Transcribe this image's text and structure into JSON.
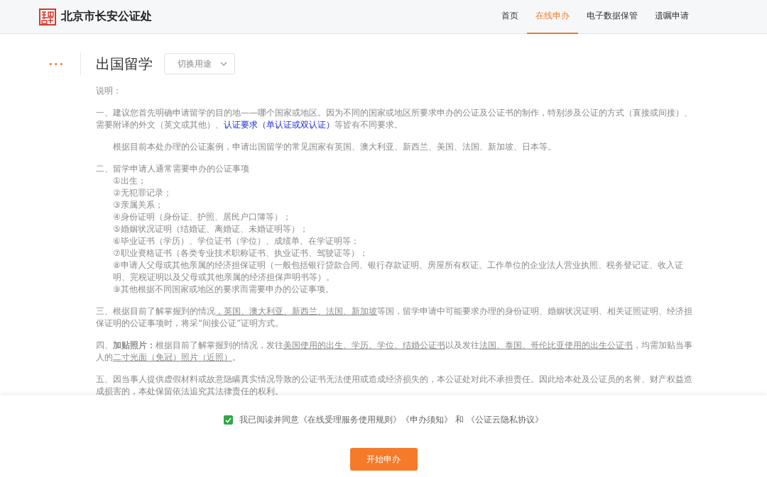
{
  "header": {
    "logo_text": "北京市长安公证处",
    "nav": [
      {
        "label": "首页",
        "selected": false
      },
      {
        "label": "在线申办",
        "selected": true
      },
      {
        "label": "电子数据保管",
        "selected": false
      },
      {
        "label": "遗嘱申请",
        "selected": false
      }
    ]
  },
  "page": {
    "more": "•••",
    "title": "出国留学",
    "switch_label": "切换用途"
  },
  "notes": [
    {
      "kind": "para",
      "segments": [
        {
          "kind": "text",
          "text": "说明："
        }
      ]
    },
    {
      "kind": "para",
      "segments": [
        {
          "kind": "text",
          "text": "一、建议您首先明确申请留学的目的地——哪个国家或地区。因为不同的国家或地区所要求申办的公证及公证书的制作，特别涉及公证的方式（直接或间接）、需要附译的外文（英文或其他）、"
        },
        {
          "kind": "link",
          "text": "认证要求（单认证或双认证）"
        },
        {
          "kind": "text",
          "text": "等皆有不同要求。"
        }
      ]
    },
    {
      "kind": "indented",
      "segments": [
        {
          "kind": "text",
          "text": "根据目前本处办理的公证案例，申请出国留学的常见国家有英国、澳大利亚、新西兰、美国、法国、新加坡、日本等。"
        }
      ]
    },
    {
      "kind": "list",
      "heading": "二、留学申请人通常需要申办的公证事项",
      "items": [
        "①出生；",
        "②无犯罪记录；",
        "③亲属关系；",
        "④身份证明（身份证、护照、居民户口簿等）；",
        "⑤婚姻状况证明（结婚证、离婚证、未婚证明等）；",
        "⑥毕业证书（学历）、学位证书（学位）、成绩单、在学证明等；",
        "⑦职业资格证书（各类专业技术职称证书、执业证书、驾驶证等）；",
        "⑧申请人父母或其他亲属的经济担保证明（一般包括银行贷款合同、银行存款证明、房屋所有权证、工作单位的企业法人营业执照、税务登记证、收入证明、完税证明以及父母或其他亲属的经济担保声明书等）。",
        "⑨其他根据不同国家或地区的要求而需要申办的公证事项。"
      ]
    },
    {
      "kind": "para",
      "segments": [
        {
          "kind": "text",
          "text": "三、根据目前了解掌握到的情况"
        },
        {
          "kind": "underline",
          "text": "，英国、澳大利亚、新西兰、法国、新加坡"
        },
        {
          "kind": "text",
          "text": "等国，留学申请中可能要求办理的身份证明、婚姻状况证明、相关证照证明、经济担保证明的公证事项时，将采“间接公证”证明方式。"
        }
      ]
    },
    {
      "kind": "para",
      "segments": [
        {
          "kind": "text",
          "text": "四、**加贴照片：**根据目前了解掌握到的情况，发往"
        },
        {
          "kind": "underline",
          "text": "美国使用的出生、学历、学位、结婚公证书"
        },
        {
          "kind": "text",
          "text": "以及发往"
        },
        {
          "kind": "underline",
          "text": "法国、泰国、哥伦比亚使用的出生公证书"
        },
        {
          "kind": "text",
          "text": "，均需加贴当事人的"
        },
        {
          "kind": "underline",
          "text": "二寸光面（免冠）照片（近照）"
        },
        {
          "kind": "text",
          "text": "。"
        }
      ]
    },
    {
      "kind": "para",
      "segments": [
        {
          "kind": "text",
          "text": "五、因当事人提供虚假材料或故意隐瞒真实情况导致的公证书无法使用或造成经济损失的，本公证处对此不承担责任。因此给本处及公证员的名誉、财产权益造成损害的，本处保留依法追究其法律责任的权利。"
        }
      ]
    }
  ],
  "agreement": {
    "checked": true,
    "text": "我已阅读并同意《在线受理服务使用规则》《申办须知》 和 《公证云隐私协议》"
  },
  "submit_button": "开始申办"
}
